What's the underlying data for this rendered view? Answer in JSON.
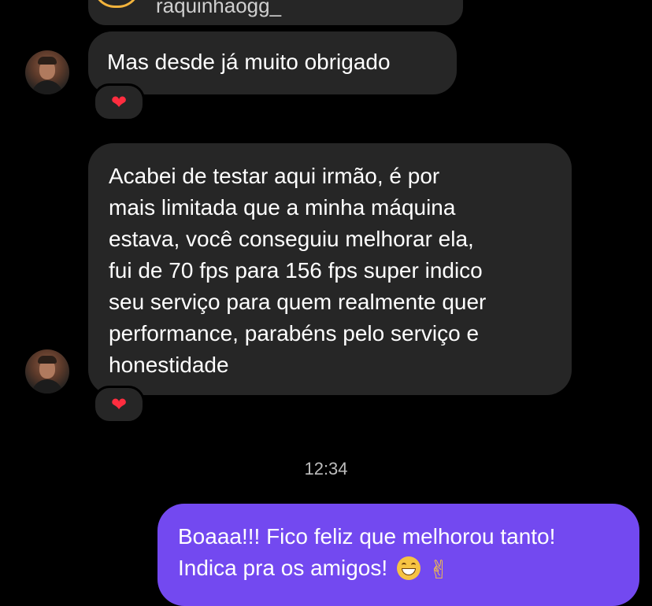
{
  "shared_post": {
    "username": "raquinhaogg_"
  },
  "messages": [
    {
      "from": "them",
      "text": "Mas desde já muito obrigado",
      "reaction": "❤"
    },
    {
      "from": "them",
      "lines": [
        "Acabei de testar aqui irmão, é por",
        "mais limitada que a minha máquina",
        "estava, você conseguiu melhorar ela,",
        "fui de 70 fps para 156 fps super indico",
        "seu serviço para quem realmente quer",
        "performance, parabéns pelo serviço e",
        "honestidade"
      ],
      "reaction": "❤"
    },
    {
      "from": "me",
      "lines": [
        "Boaaa!!! Fico feliz que melhorou tanto!",
        "Indica pra os amigos!"
      ],
      "emojis": [
        "grinning-face-emoji",
        "victory-hand-emoji"
      ],
      "victory_glyph": "✌"
    }
  ],
  "timestamp": "12:34",
  "colors": {
    "background": "#000000",
    "received_bubble": "#262626",
    "sent_bubble": "#7349f0",
    "heart": "#ff2d3f"
  }
}
